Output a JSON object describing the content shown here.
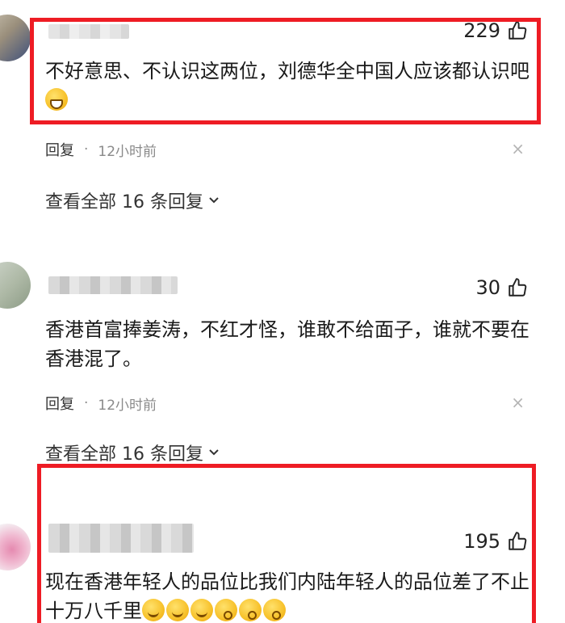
{
  "comments": [
    {
      "likes": "229",
      "text": "不好意思、不认识这两位，刘德华全中国人应该都认识吧",
      "emojis": [
        "grin-emoji"
      ],
      "reply_label": "回复",
      "time": "12小时前",
      "view_replies": "查看全部 16 条回复"
    },
    {
      "likes": "30",
      "text": "香港首富捧姜涛，不红才怪，谁敢不给面子，谁就不要在香港混了。",
      "emojis": [],
      "reply_label": "回复",
      "time": "12小时前",
      "view_replies": "查看全部 16 条回复"
    },
    {
      "likes": "195",
      "text": "现在香港年轻人的品位比我们内陆年轻人的品位差了不止十万八千里",
      "emojis": [
        "smirk-emoji",
        "smirk-emoji",
        "smirk-emoji",
        "kiss-emoji",
        "kiss-emoji",
        "kiss-emoji"
      ]
    }
  ],
  "separator_dot": "·",
  "close_glyph": "×",
  "colors": {
    "highlight": "#ee1c24",
    "meta_text": "#8a8a8a"
  }
}
